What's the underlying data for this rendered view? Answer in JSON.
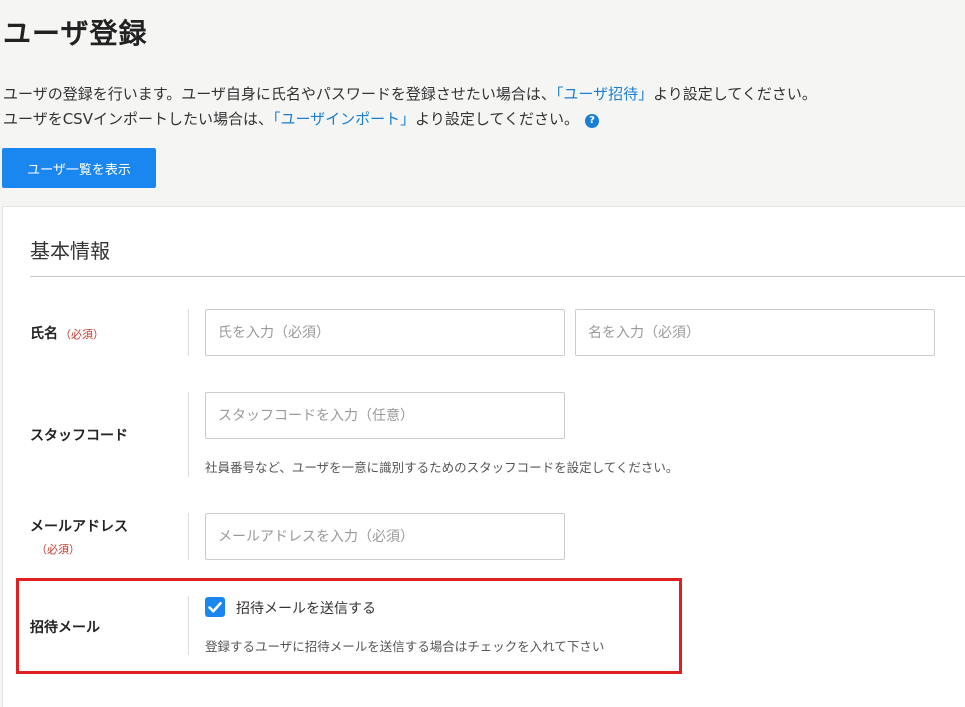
{
  "page": {
    "title": "ユーザ登録",
    "description_line1_prefix": "ユーザの登録を行います。ユーザ自身に氏名やパスワードを登録させたい場合は、",
    "invite_link": "「ユーザ招待」",
    "description_line1_suffix": "より設定してください。",
    "description_line2_prefix": "ユーザをCSVインポートしたい場合は、",
    "import_link": "「ユーザインポート」",
    "description_line2_suffix": "より設定してください。",
    "help_icon_glyph": "?",
    "list_button_label": "ユーザ一覧を表示"
  },
  "form": {
    "section_title": "基本情報",
    "name": {
      "label": "氏名",
      "required": "（必須）",
      "last_placeholder": "氏を入力（必須）",
      "first_placeholder": "名を入力（必須）"
    },
    "staff_code": {
      "label": "スタッフコード",
      "placeholder": "スタッフコードを入力（任意）",
      "help": "社員番号など、ユーザを一意に識別するためのスタッフコードを設定してください。"
    },
    "email": {
      "label": "メールアドレス",
      "required": "（必須）",
      "placeholder": "メールアドレスを入力（必須）"
    },
    "invite_mail": {
      "label": "招待メール",
      "checkbox_label": "招待メールを送信する",
      "checked": true,
      "help": "登録するユーザに招待メールを送信する場合はチェックを入れて下さい"
    }
  },
  "colors": {
    "accent": "#1a86f0",
    "link": "#1a7fd4",
    "required": "#c0392b",
    "highlight": "#e02020"
  },
  "icons": {
    "help": "question-circle-icon",
    "check": "check-icon"
  }
}
